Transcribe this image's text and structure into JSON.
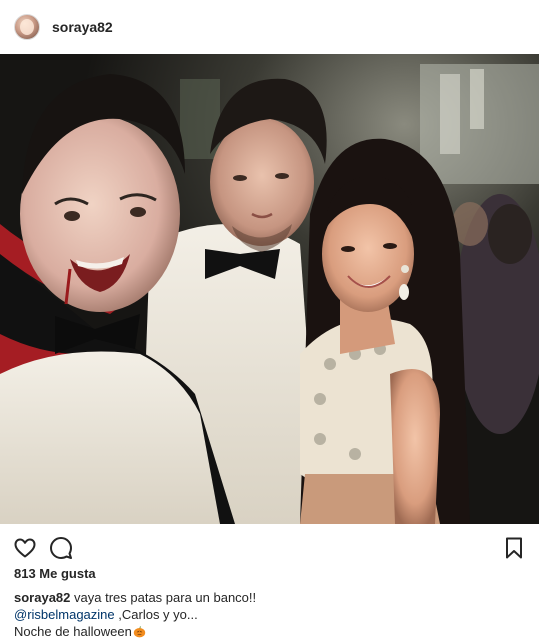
{
  "post": {
    "author": "soraya82",
    "likes_text": "813 Me gusta",
    "caption": {
      "username": "soraya82",
      "line1": "vaya tres patas para un banco!!",
      "mention": "@risbelmagazine",
      "line2_rest": ",Carlos y yo...",
      "line3": "Noche de halloween",
      "emoji": "pumpkin-emoji"
    }
  },
  "icons": {
    "like": "heart-icon",
    "comment": "comment-icon",
    "save": "bookmark-icon"
  },
  "colors": {
    "text": "#262626",
    "mention": "#003569",
    "border": "#dbdbdb"
  }
}
